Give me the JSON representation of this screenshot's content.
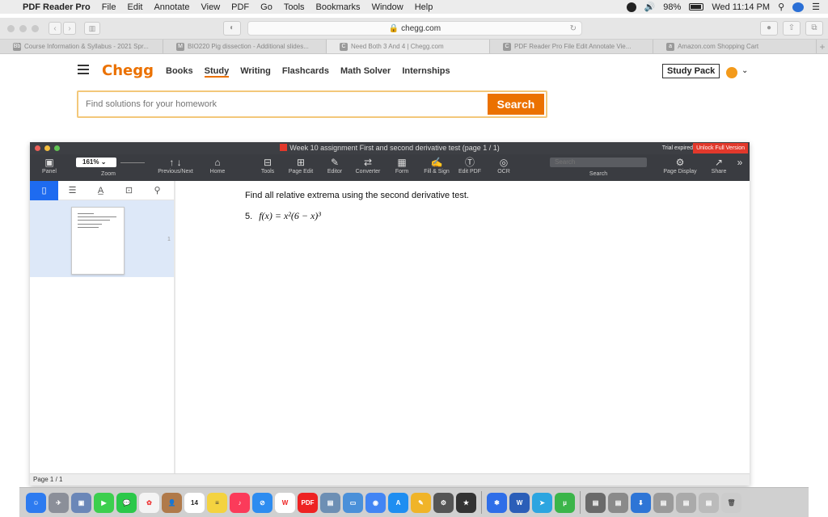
{
  "menubar": {
    "apple_glyph": "",
    "app_name": "PDF Reader Pro",
    "items": [
      "File",
      "Edit",
      "Annotate",
      "View",
      "PDF",
      "Go",
      "Tools",
      "Bookmarks",
      "Window",
      "Help"
    ],
    "battery": "98%",
    "clock": "Wed 11:14 PM"
  },
  "browser": {
    "url": "chegg.com",
    "tabs": [
      {
        "label": "Course Information & Syllabus - 2021 Spr...",
        "fav": "Bb"
      },
      {
        "label": "BIO220 Pig dissection - Additional slides...",
        "fav": "M"
      },
      {
        "label": "Need Both 3 And 4 | Chegg.com",
        "fav": "C"
      },
      {
        "label": "PDF Reader Pro File Edit Annotate Vie...",
        "fav": "C"
      },
      {
        "label": "Amazon.com Shopping Cart",
        "fav": "a"
      }
    ]
  },
  "chegg": {
    "logo": "Chegg",
    "nav": [
      "Books",
      "Study",
      "Writing",
      "Flashcards",
      "Math Solver",
      "Internships"
    ],
    "study_pack": "Study Pack",
    "search_placeholder": "Find solutions for your homework",
    "search_button": "Search",
    "accent": "#eb7100"
  },
  "pdf": {
    "title": "Week 10 assignment First and second derivative test (page 1 / 1)",
    "trial": "Trial expired",
    "unlock": "Unlock Full Version",
    "zoom": "161%",
    "toolbar": {
      "panel": "Panel",
      "zoom": "Zoom",
      "prev_next": "Previous/Next",
      "home": "Home",
      "tools": "Tools",
      "page_edit": "Page Edit",
      "editor": "Editor",
      "converter": "Converter",
      "form": "Form",
      "fill_sign": "Fill & Sign",
      "edit_pdf": "Edit PDF",
      "ocr": "OCR",
      "search": "Search",
      "search_placeholder": "Search",
      "page_display": "Page Display",
      "share": "Share"
    },
    "thumb_page": "1",
    "heading": "Find all relative extrema using the second derivative test.",
    "problem_number": "5.",
    "problem": "f(x) = x²(6 − x)³",
    "status": "Page 1 / 1"
  },
  "dock": {
    "calendar_day": "14",
    "pdf_label": "PDF",
    "word_label": "W"
  }
}
